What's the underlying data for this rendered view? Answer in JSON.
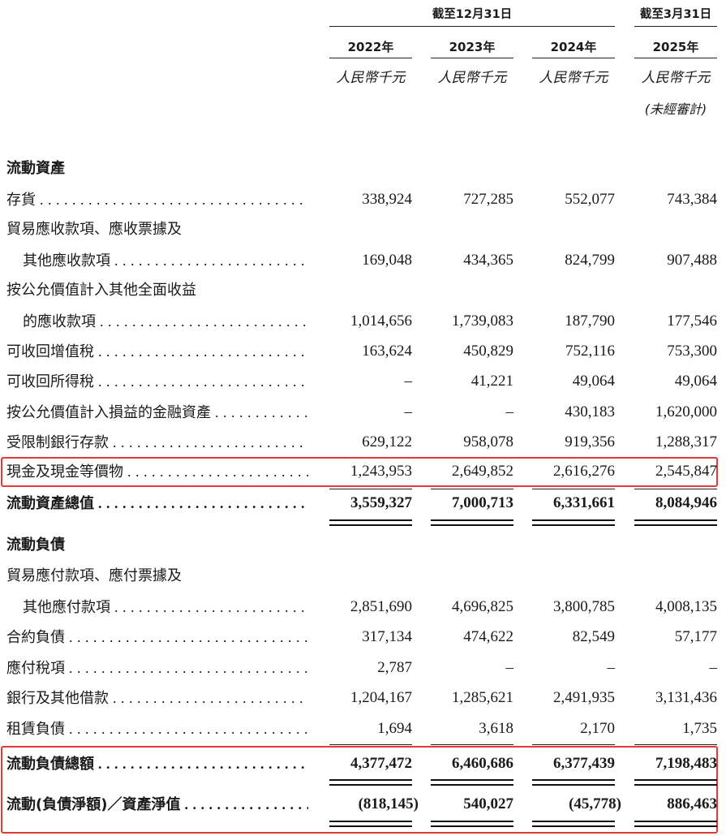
{
  "header": {
    "group_dec": "截至12月31日",
    "group_mar": "截至3月31日",
    "years": [
      "2022年",
      "2023年",
      "2024年",
      "2025年"
    ],
    "unit": "人民幣千元",
    "unaudited_note": "(未經審計)"
  },
  "sections": {
    "current_assets": "流動資產",
    "current_liabilities": "流動負債"
  },
  "rows": {
    "inventory": {
      "label": "存貨",
      "values": [
        "338,924",
        "727,285",
        "552,077",
        "743,384"
      ]
    },
    "trade_receivables_l1": {
      "label": "貿易應收款項、應收票據及"
    },
    "trade_receivables": {
      "label": "其他應收款項",
      "values": [
        "169,048",
        "434,365",
        "824,799",
        "907,488"
      ]
    },
    "fvoci_l1": {
      "label": "按公允價值計入其他全面收益"
    },
    "fvoci": {
      "label": "的應收款項",
      "values": [
        "1,014,656",
        "1,739,083",
        "187,790",
        "177,546"
      ]
    },
    "vat": {
      "label": "可收回增值稅",
      "values": [
        "163,624",
        "450,829",
        "752,116",
        "753,300"
      ]
    },
    "income_tax": {
      "label": "可收回所得稅",
      "values": [
        "–",
        "41,221",
        "49,064",
        "49,064"
      ]
    },
    "fvtpl": {
      "label": "按公允價值計入損益的金融資產",
      "values": [
        "–",
        "–",
        "430,183",
        "1,620,000"
      ]
    },
    "restricted": {
      "label": "受限制銀行存款",
      "values": [
        "629,122",
        "958,078",
        "919,356",
        "1,288,317"
      ]
    },
    "cash": {
      "label": "現金及現金等價物",
      "values": [
        "1,243,953",
        "2,649,852",
        "2,616,276",
        "2,545,847"
      ]
    },
    "total_current_assets": {
      "label": "流動資產總值",
      "values": [
        "3,559,327",
        "7,000,713",
        "6,331,661",
        "8,084,946"
      ]
    },
    "trade_payables_l1": {
      "label": "貿易應付款項、應付票據及"
    },
    "trade_payables": {
      "label": "其他應付款項",
      "values": [
        "2,851,690",
        "4,696,825",
        "3,800,785",
        "4,008,135"
      ]
    },
    "contract_liabilities": {
      "label": "合約負債",
      "values": [
        "317,134",
        "474,622",
        "82,549",
        "57,177"
      ]
    },
    "tax_payable": {
      "label": "應付稅項",
      "values": [
        "2,787",
        "–",
        "–",
        "–"
      ]
    },
    "borrowings": {
      "label": "銀行及其他借款",
      "values": [
        "1,204,167",
        "1,285,621",
        "2,491,935",
        "3,131,436"
      ]
    },
    "lease": {
      "label": "租賃負債",
      "values": [
        "1,694",
        "3,618",
        "2,170",
        "1,735"
      ]
    },
    "total_current_liabilities": {
      "label": "流動負債總額",
      "values": [
        "4,377,472",
        "6,460,686",
        "6,377,439",
        "7,198,483"
      ]
    },
    "net_current": {
      "label": "流動(負債淨額)／資產淨值",
      "values": [
        "(818,145)",
        "540,027",
        "(45,778)",
        "886,463"
      ]
    }
  },
  "colors": {
    "highlight": "#e53935",
    "text": "#1a1a1a"
  }
}
